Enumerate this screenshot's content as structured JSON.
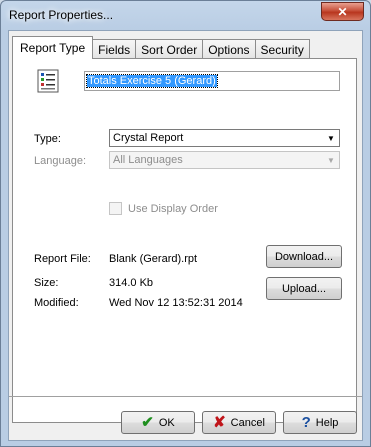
{
  "window": {
    "title": "Report Properties...",
    "close_glyph": "✕"
  },
  "tabs": [
    {
      "label": "Report Type",
      "active": true
    },
    {
      "label": "Fields"
    },
    {
      "label": "Sort Order"
    },
    {
      "label": "Options"
    },
    {
      "label": "Security"
    }
  ],
  "report": {
    "name": "Totals Exercise 5  (Gerard)",
    "icon": "report-icon"
  },
  "type_field": {
    "label": "Type:",
    "value": "Crystal Report"
  },
  "language_field": {
    "label": "Language:",
    "value": "All Languages"
  },
  "display_order": {
    "label": "Use Display Order",
    "checked": false
  },
  "details": {
    "file_label": "Report File:",
    "file_value": "Blank (Gerard).rpt",
    "size_label": "Size:",
    "size_value": "314.0 Kb",
    "modified_label": "Modified:",
    "modified_value": "Wed Nov 12 13:52:31 2014"
  },
  "buttons": {
    "download": "Download...",
    "upload": "Upload...",
    "ok": "OK",
    "cancel": "Cancel",
    "help": "Help"
  },
  "colors": {
    "ok_icon": "#1f8f1f",
    "cancel_icon": "#c0151b",
    "help_icon": "#1a4fa0"
  }
}
